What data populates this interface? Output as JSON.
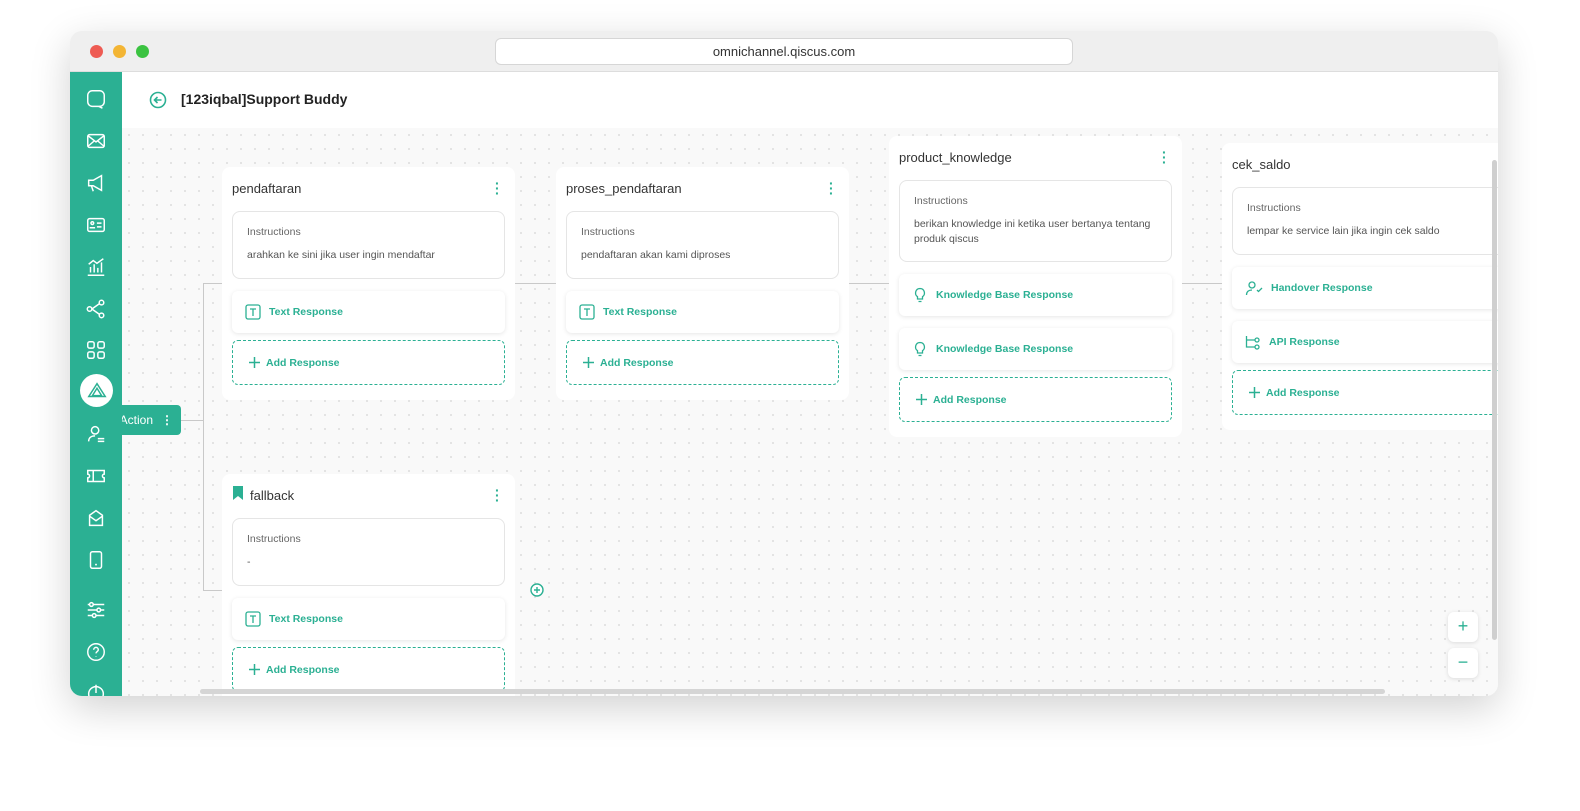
{
  "browser": {
    "url": "omnichannel.qiscus.com"
  },
  "header": {
    "title": "[123iqbal]Support Buddy"
  },
  "sidebar": {
    "items": [
      "chat-icon",
      "mail-icon",
      "megaphone-icon",
      "contact-card-icon",
      "analytics-icon",
      "flow-icon",
      "apps-icon",
      "ai-agent-icon",
      "user-role-icon",
      "ticket-icon",
      "inbox-icon",
      "mobile-icon",
      "settings-sliders-icon",
      "help-icon",
      "power-icon"
    ],
    "active": "ai-agent-icon"
  },
  "action_node": {
    "label": "Action"
  },
  "instructions_label": "Instructions",
  "add_response_label": "Add Response",
  "accent": "#2bb093",
  "cards": [
    {
      "title": "pendaftaran",
      "instruction": "arahkan ke sini jika user ingin mendaftar",
      "responses": [
        {
          "type": "text",
          "label": "Text Response"
        }
      ]
    },
    {
      "title": "proses_pendaftaran",
      "instruction": "pendaftaran akan kami diproses",
      "responses": [
        {
          "type": "text",
          "label": "Text Response"
        }
      ]
    },
    {
      "title": "product_knowledge",
      "instruction": "berikan knowledge ini ketika user bertanya tentang produk qiscus",
      "responses": [
        {
          "type": "kb",
          "label": "Knowledge Base Response"
        },
        {
          "type": "kb",
          "label": "Knowledge Base Response"
        }
      ]
    },
    {
      "title": "cek_saldo",
      "instruction": "lempar ke service lain jika ingin cek saldo",
      "responses": [
        {
          "type": "handover",
          "label": "Handover Response"
        },
        {
          "type": "api",
          "label": "API Response"
        }
      ]
    },
    {
      "title": "fallback",
      "instruction": "-",
      "bookmark": true,
      "responses": [
        {
          "type": "text",
          "label": "Text Response"
        }
      ]
    }
  ],
  "zoom": {
    "in": "+",
    "out": "−"
  }
}
